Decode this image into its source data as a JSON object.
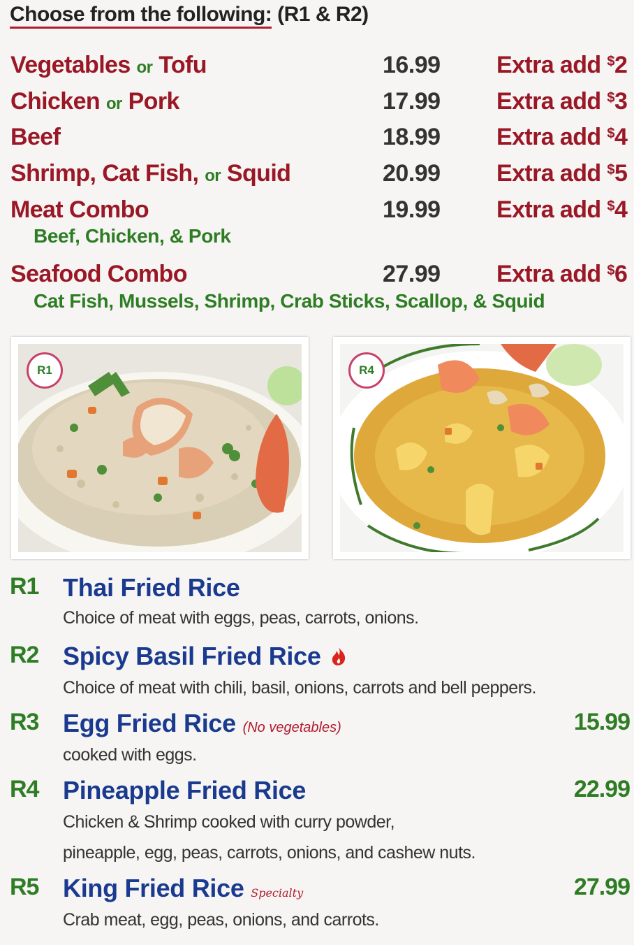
{
  "header": {
    "underlined": "Choose from the following:",
    "rest": "(R1 & R2)"
  },
  "choices": [
    {
      "name": "Vegetables",
      "or": "or",
      "alt": "Tofu",
      "price": "16.99",
      "extra_label": "Extra add",
      "extra_cur": "$",
      "extra_amount": "2"
    },
    {
      "name": "Chicken",
      "or": "or",
      "alt": "Pork",
      "price": "17.99",
      "extra_label": "Extra add",
      "extra_cur": "$",
      "extra_amount": "3"
    },
    {
      "name": "Beef",
      "price": "18.99",
      "extra_label": "Extra add",
      "extra_cur": "$",
      "extra_amount": "4"
    },
    {
      "name": "Shrimp, Cat Fish,",
      "or": "or",
      "alt": "Squid",
      "price": "20.99",
      "extra_label": "Extra add",
      "extra_cur": "$",
      "extra_amount": "5"
    },
    {
      "name": "Meat Combo",
      "price": "19.99",
      "extra_label": "Extra add",
      "extra_cur": "$",
      "extra_amount": "4",
      "sub": "Beef, Chicken, & Pork"
    },
    {
      "name": "Seafood Combo",
      "price": "27.99",
      "extra_label": "Extra add",
      "extra_cur": "$",
      "extra_amount": "6",
      "sub": "Cat Fish, Mussels, Shrimp, Crab Sticks, Scallop, & Squid"
    }
  ],
  "photos": [
    {
      "tag": "R1"
    },
    {
      "tag": "R4"
    }
  ],
  "items": [
    {
      "code": "R1",
      "title": "Thai Fried Rice",
      "desc": [
        "Choice of meat with eggs, peas, carrots, onions."
      ]
    },
    {
      "code": "R2",
      "title": "Spicy Basil Fried Rice",
      "desc": [
        "Choice of meat with chili, basil, onions, carrots and bell peppers."
      ]
    },
    {
      "code": "R3",
      "title": "Egg Fried Rice",
      "note": "(No vegetables)",
      "price": "15.99",
      "desc": [
        "cooked with eggs."
      ]
    },
    {
      "code": "R4",
      "title": "Pineapple Fried Rice",
      "price": "22.99",
      "desc": [
        "Chicken & Shrimp cooked with curry powder,",
        "pineapple, egg, peas, carrots, onions, and cashew nuts."
      ]
    },
    {
      "code": "R5",
      "title": "King Fried Rice",
      "special": "Specialty",
      "price": "27.99",
      "desc": [
        "Crab meat, egg, peas, onions, and carrots."
      ]
    }
  ],
  "colors": {
    "red": "#9a1726",
    "green": "#2e7d25",
    "blue": "#1a3a8f",
    "tag_ring": "#c9406a"
  },
  "icons": {
    "spicy": "chili-flame-icon"
  }
}
